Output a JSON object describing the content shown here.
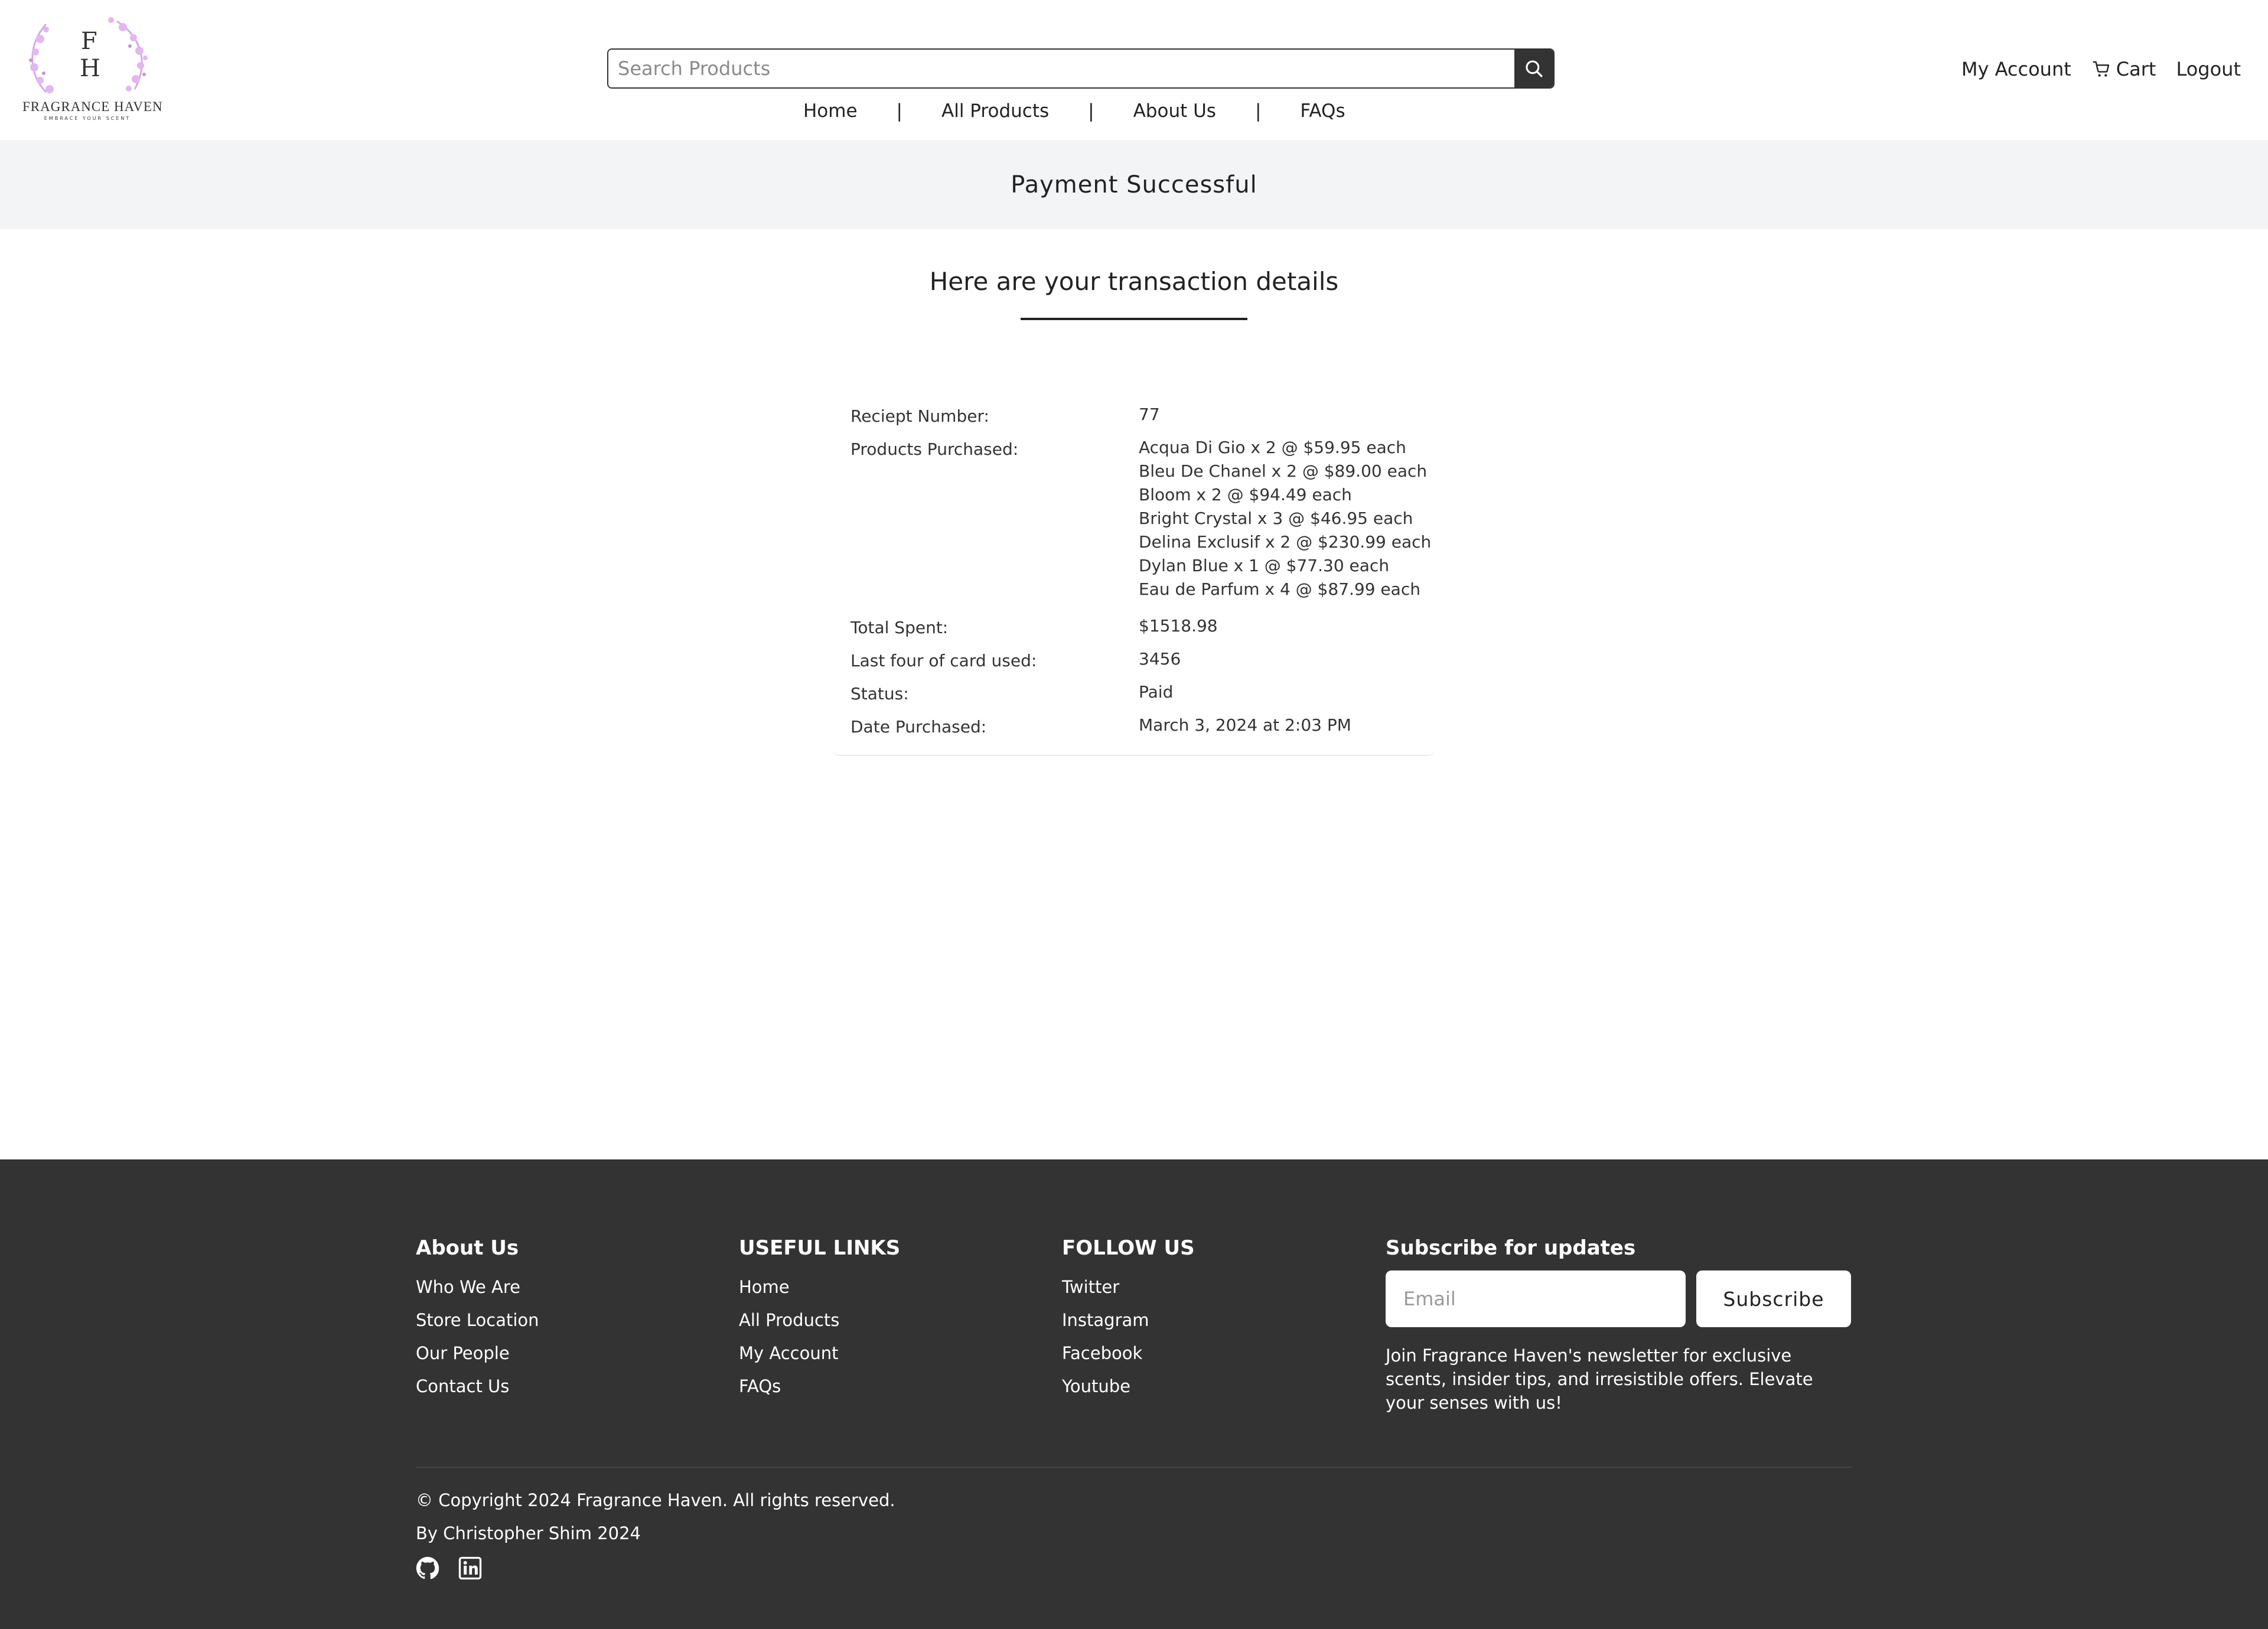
{
  "header": {
    "logo": {
      "letter_top": "F",
      "letter_bottom": "H",
      "name": "FRAGRANCE HAVEN",
      "tagline": "EMBRACE YOUR SCENT"
    },
    "search": {
      "placeholder": "Search Products",
      "icon": "search-icon"
    },
    "nav": {
      "home": "Home",
      "all_products": "All Products",
      "about_us": "About Us",
      "faqs": "FAQs",
      "separator": "|"
    },
    "account": {
      "my_account": "My Account",
      "cart": "Cart",
      "cart_icon": "cart-icon",
      "logout": "Logout"
    }
  },
  "banner": {
    "title": "Payment Successful"
  },
  "main": {
    "heading": "Here are your transaction details",
    "details": {
      "receipt_label": "Reciept Number:",
      "receipt_value": "77",
      "products_label": "Products Purchased:",
      "products": [
        "Acqua Di Gio x 2 @ $59.95 each",
        "Bleu De Chanel x 2 @ $89.00 each",
        "Bloom x 2 @ $94.49 each",
        "Bright Crystal x 3 @ $46.95 each",
        "Delina Exclusif x 2 @ $230.99 each",
        "Dylan Blue x 1 @ $77.30 each",
        "Eau de Parfum x 4 @ $87.99 each"
      ],
      "total_label": "Total Spent:",
      "total_value": "$1518.98",
      "card_label": "Last four of card used:",
      "card_value": "3456",
      "status_label": "Status:",
      "status_value": "Paid",
      "date_label": "Date Purchased:",
      "date_value": "March 3, 2024 at 2:03 PM"
    }
  },
  "footer": {
    "about": {
      "heading": "About Us",
      "links": [
        "Who We Are",
        "Store Location",
        "Our People",
        "Contact Us"
      ]
    },
    "useful": {
      "heading": "USEFUL LINKS",
      "links": [
        "Home",
        "All Products",
        "My Account",
        "FAQs"
      ]
    },
    "follow": {
      "heading": "FOLLOW US",
      "links": [
        "Twitter",
        "Instagram",
        "Facebook",
        "Youtube"
      ]
    },
    "subscribe": {
      "heading": "Subscribe for updates",
      "email_placeholder": "Email",
      "button": "Subscribe",
      "text": "Join Fragrance Haven's newsletter for exclusive scents, insider tips, and irresistible offers. Elevate your senses with us!"
    },
    "copyright": "© Copyright 2024 Fragrance Haven. All rights reserved.",
    "byline": "By Christopher Shim 2024",
    "social_icons": [
      "github-icon",
      "linkedin-icon"
    ]
  },
  "colors": {
    "footer_bg": "#333333",
    "banner_bg": "#f3f4f6",
    "logo_accent": "#d9a6e8",
    "text": "#222222"
  }
}
